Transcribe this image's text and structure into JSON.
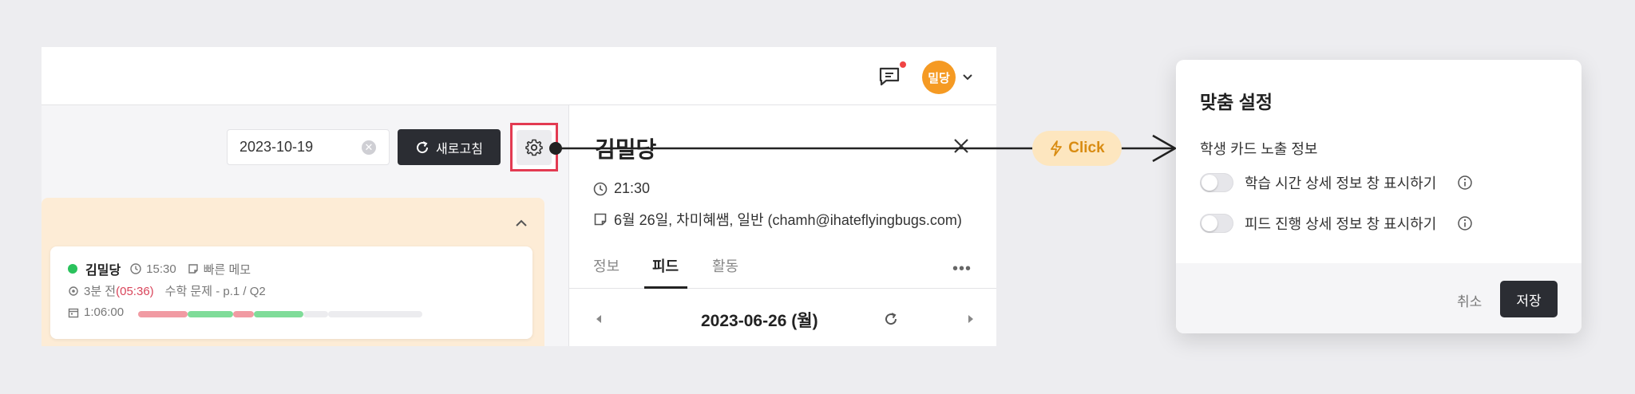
{
  "topbar": {
    "avatar_label": "밀당"
  },
  "toolbar": {
    "date_value": "2023-10-19",
    "refresh_label": "새로고침"
  },
  "student_card": {
    "name": "김밀당",
    "time": "15:30",
    "memo_label": "빠른 메모",
    "recent": "3분 전",
    "recent_elapsed": "(05:36)",
    "task": "수학 문제 - p.1 / Q2",
    "duration": "1:06:00",
    "progress_segments": [
      {
        "color": "#f19ba3",
        "fraction": 0.13
      },
      {
        "color": "#7fdc99",
        "fraction": 0.12
      },
      {
        "color": "#f19ba3",
        "fraction": 0.055
      },
      {
        "color": "#7fdc99",
        "fraction": 0.13
      },
      {
        "color": "#ececef",
        "fraction": 0.065
      },
      {
        "color": "#ececef",
        "fraction": 0.25
      }
    ]
  },
  "detail": {
    "name": "김밀당",
    "time": "21:30",
    "memo": "6월 26일, 차미혜쌤, 일반 (chamh@ihateflyingbugs.com)",
    "tabs": [
      {
        "label": "정보",
        "active": false
      },
      {
        "label": "피드",
        "active": true
      },
      {
        "label": "활동",
        "active": false
      }
    ],
    "feed_date": "2023-06-26 (월)"
  },
  "annotation": {
    "click_label": "Click",
    "accent_color": "#e33b52"
  },
  "modal": {
    "title": "맞춤 설정",
    "section_label": "학생 카드 노출 정보",
    "options": [
      {
        "label": "학습 시간 상세 정보 창 표시하기",
        "enabled": false
      },
      {
        "label": "피드 진행 상세 정보 창 표시하기",
        "enabled": false
      }
    ],
    "cancel_label": "취소",
    "save_label": "저장"
  }
}
